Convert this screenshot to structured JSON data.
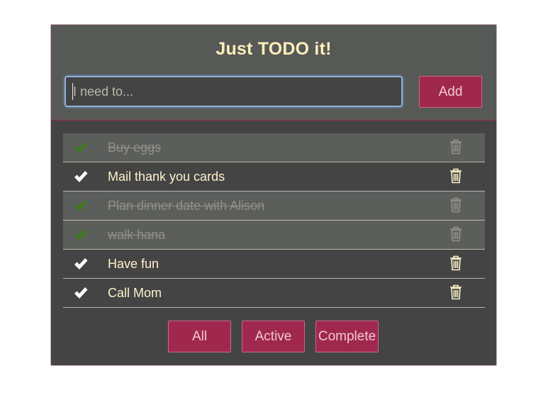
{
  "app": {
    "title": "Just TODO it!"
  },
  "new_todo": {
    "placeholder": "I need to...",
    "add_label": "Add"
  },
  "todos": [
    {
      "text": "Buy eggs",
      "completed": true
    },
    {
      "text": "Mail thank you cards",
      "completed": false
    },
    {
      "text": "Plan dinner date with Alison",
      "completed": true
    },
    {
      "text": "walk hana",
      "completed": true
    },
    {
      "text": "Have fun",
      "completed": false
    },
    {
      "text": "Call Mom",
      "completed": false
    }
  ],
  "filters": {
    "all": "All",
    "active": "Active",
    "complete": "Complete"
  },
  "icons": {
    "check": "checkmark-icon",
    "delete": "trash-icon"
  },
  "colors": {
    "accent": "#a0284e",
    "title_text": "#fbeeb8",
    "check_done": "#3f7a1f",
    "check_active": "#ffffff",
    "panel": "#444444",
    "header": "#575957"
  }
}
